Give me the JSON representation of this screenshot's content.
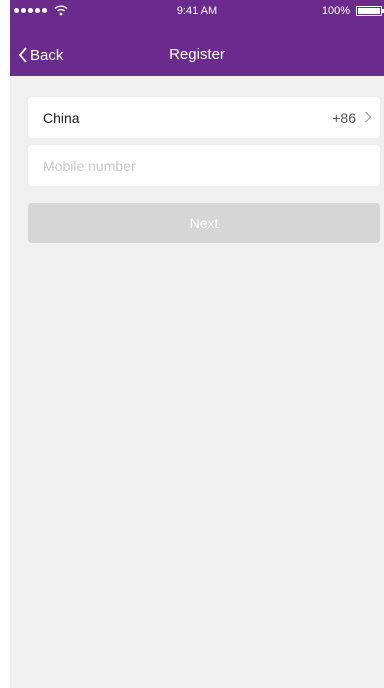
{
  "status_bar": {
    "time": "9:41 AM",
    "battery_percent": "100%",
    "battery_level": 1.0
  },
  "nav": {
    "back_label": "Back",
    "title": "Register"
  },
  "form": {
    "country": {
      "name": "China",
      "code": "+86"
    },
    "mobile": {
      "value": "",
      "placeholder": "Mobile number"
    },
    "next_label": "Next"
  },
  "colors": {
    "header": "#6a2b8d",
    "background": "#f0f0f0",
    "disabled_button": "#d6d6d6"
  }
}
